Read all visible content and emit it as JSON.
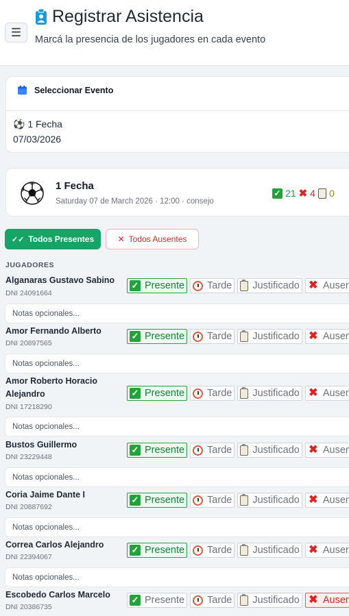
{
  "header": {
    "title": "Registrar Asistencia",
    "subtitle": "Marcá la presencia de los jugadores en cada evento"
  },
  "selector": {
    "label": "Seleccionar Evento",
    "value_name": "1 Fecha",
    "value_date": "07/03/2026"
  },
  "event": {
    "title": "1 Fecha",
    "meta": "Saturday 07 de March 2026 · 12:00 · consejo",
    "stats": {
      "present": "21",
      "absent": "4",
      "justified": "0"
    }
  },
  "actions": {
    "all_present": "Todos Presentes",
    "all_absent": "Todos Ausentes"
  },
  "section_label": "JUGADORES",
  "options": {
    "present": "Presente",
    "late": "Tarde",
    "justified": "Justificado",
    "absent": "Ausente"
  },
  "notes_placeholder": "Notas opcionales...",
  "players": [
    {
      "name": "Alganaras Gustavo Sabino",
      "dni": "DNI 24091664",
      "status": "present"
    },
    {
      "name": "Amor Fernando Alberto",
      "dni": "DNI 20897565",
      "status": "present"
    },
    {
      "name": "Amor Roberto Horacio Alejandro",
      "dni": "DNI 17218290",
      "status": "present"
    },
    {
      "name": "Bustos Guillermo",
      "dni": "DNI 23229448",
      "status": "present"
    },
    {
      "name": "Coria Jaime Dante I",
      "dni": "DNI 20887692",
      "status": "present"
    },
    {
      "name": "Correa Carlos Alejandro",
      "dni": "DNI 22394067",
      "status": "present"
    },
    {
      "name": "Escobedo Carlos Marcelo",
      "dni": "DNI 20386735",
      "status": "absent"
    }
  ],
  "colors": {
    "accent_green": "#16a366",
    "present_green": "#22a33a",
    "absent_red": "#dc2626",
    "justified_amber": "#d97706"
  }
}
